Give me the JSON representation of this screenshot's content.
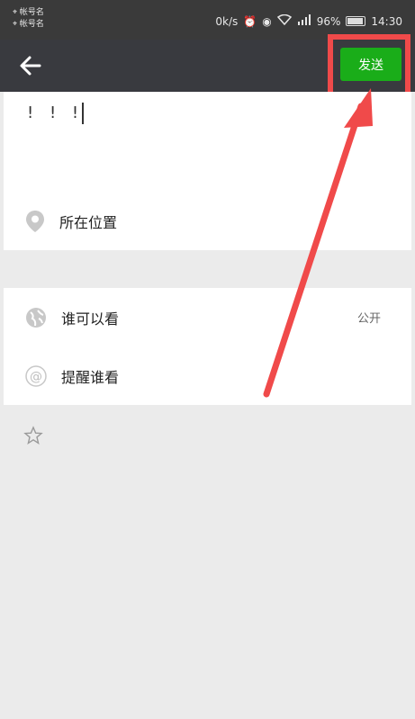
{
  "status_bar": {
    "left_line1": "⌖ 帐号名",
    "left_line2": "⌖ 帐号名",
    "speed": "0k/s",
    "battery_pct": "96%",
    "time": "14:30"
  },
  "title_bar": {
    "back_icon": "arrow-left-icon",
    "send_label": "发送",
    "send_color": "#1aad19"
  },
  "compose": {
    "text": "! ! !"
  },
  "location": {
    "label": "所在位置",
    "icon": "location-pin-icon"
  },
  "visibility": {
    "label": "谁可以看",
    "value": "公开",
    "icon": "globe-icon"
  },
  "mention": {
    "label": "提醒谁看",
    "icon": "at-icon"
  },
  "extra": {
    "icon": "star-icon"
  },
  "annotation": {
    "highlight_color": "#f04a4a"
  }
}
